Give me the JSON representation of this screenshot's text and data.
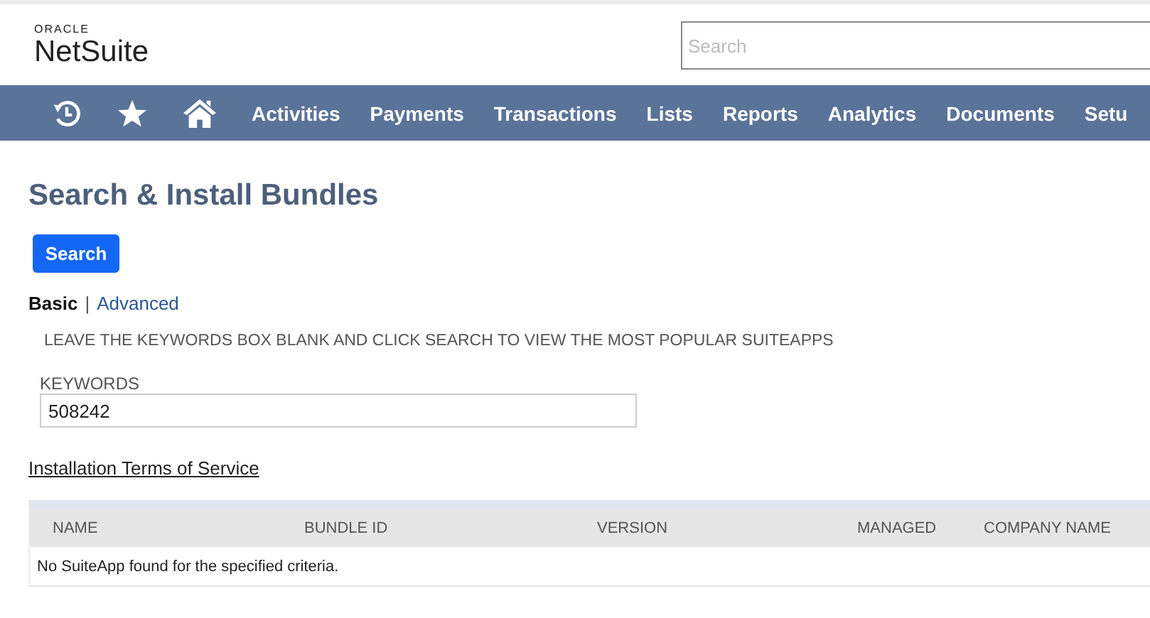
{
  "logo": {
    "brand": "ORACLE",
    "product": "NetSuite"
  },
  "search": {
    "placeholder": "Search"
  },
  "nav": {
    "icons": [
      {
        "kind": "history"
      },
      {
        "kind": "star"
      },
      {
        "kind": "home"
      }
    ],
    "items": [
      "Activities",
      "Payments",
      "Transactions",
      "Lists",
      "Reports",
      "Analytics",
      "Documents",
      "Setu"
    ]
  },
  "page": {
    "title": "Search & Install Bundles",
    "search_button": "Search",
    "mode_separator": "|",
    "modes": [
      {
        "label": "Basic",
        "selected": true
      },
      {
        "label": "Advanced",
        "selected": false
      }
    ],
    "hint": "LEAVE THE KEYWORDS BOX BLANK AND CLICK SEARCH TO VIEW THE MOST POPULAR SUITEAPPS",
    "keywords": {
      "label": "KEYWORDS",
      "value": "508242"
    },
    "terms_link": "Installation Terms of Service"
  },
  "table": {
    "columns": [
      "NAME",
      "BUNDLE ID",
      "VERSION",
      "MANAGED",
      "COMPANY NAME"
    ],
    "empty_message": "No SuiteApp found for the specified criteria."
  }
}
